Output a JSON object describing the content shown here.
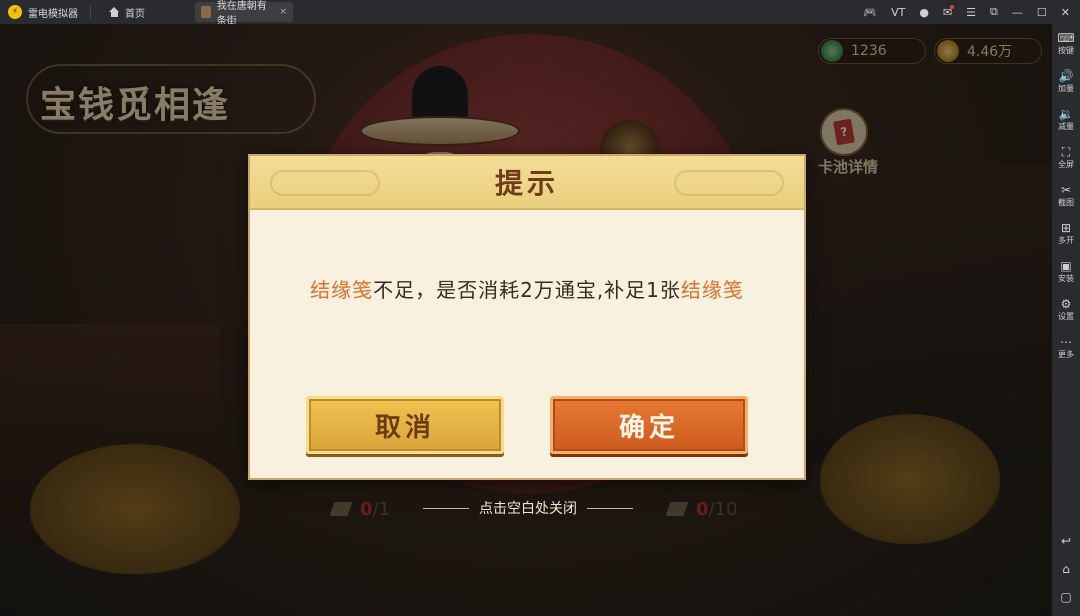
{
  "emulator": {
    "app_name": "雷电模拟器",
    "home_tab": "首页",
    "game_tab": "我在唐朝有条街",
    "tab_close": "×",
    "right_icons": {
      "gamepad": "🎮",
      "vt": "VT",
      "user": "●",
      "mail": "✉",
      "menu": "☰",
      "popout": "⧉",
      "minimize": "—",
      "maximize": "☐",
      "close": "✕"
    }
  },
  "sidebar": {
    "items": [
      {
        "label": "按键",
        "icon": "keyboard-icon",
        "glyph": "⌨"
      },
      {
        "label": "加量",
        "icon": "volume-up-icon",
        "glyph": "🔊"
      },
      {
        "label": "减量",
        "icon": "volume-down-icon",
        "glyph": "🔉"
      },
      {
        "label": "全屏",
        "icon": "fullscreen-icon",
        "glyph": "⛶"
      },
      {
        "label": "截图",
        "icon": "scissors-icon",
        "glyph": "✂"
      },
      {
        "label": "多开",
        "icon": "multi-instance-icon",
        "glyph": "⊞"
      },
      {
        "label": "安装",
        "icon": "apk-install-icon",
        "glyph": "▣"
      },
      {
        "label": "设置",
        "icon": "settings-icon",
        "glyph": "⚙"
      },
      {
        "label": "更多",
        "icon": "more-icon",
        "glyph": "⋯"
      }
    ],
    "bottom": {
      "back": "↩",
      "home": "⌂",
      "recent": "▢"
    }
  },
  "game": {
    "event_title": "宝钱觅相逢",
    "currency": {
      "jade": "1236",
      "coin": "4.46万"
    },
    "pool_button": {
      "label": "卡池详情",
      "glyph": "?"
    },
    "counter_left": {
      "current": "0",
      "total": "/1"
    },
    "counter_right": {
      "current": "0",
      "total": "/10"
    },
    "close_hint": "点击空白处关闭"
  },
  "dialog": {
    "title": "提示",
    "message": {
      "item1": "结缘笺",
      "middle": "不足，是否消耗2万通宝,补足1张",
      "item2": "结缘笺"
    },
    "cancel_label": "取消",
    "confirm_label": "确定"
  },
  "colors": {
    "highlight": "#e0702a",
    "confirm_button": "#d9642a",
    "cancel_button": "#e6b446",
    "dialog_bg": "#f8f1df"
  }
}
